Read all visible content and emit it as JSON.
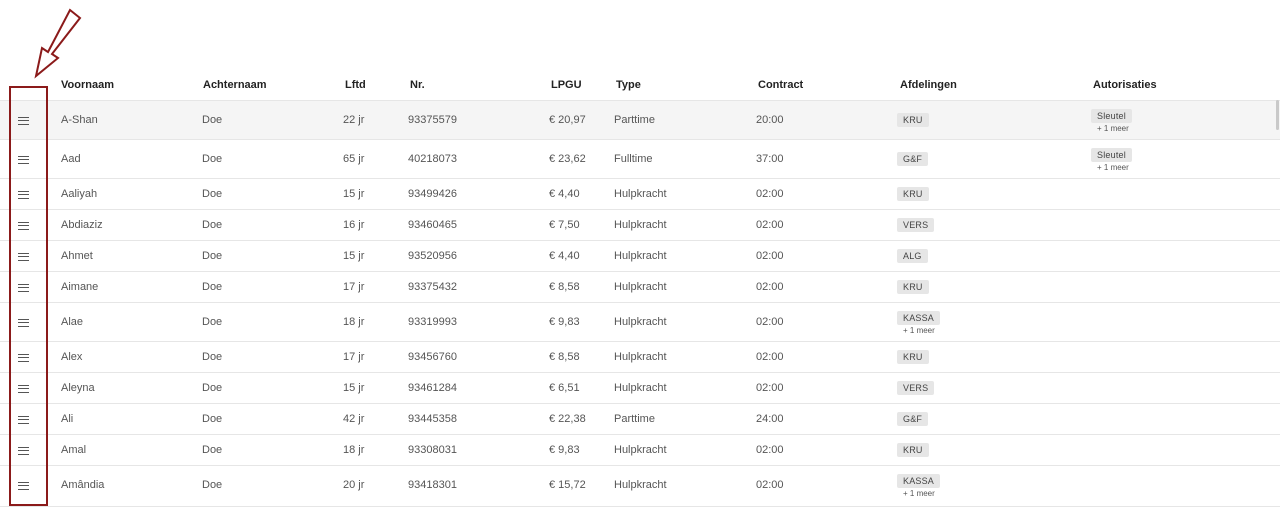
{
  "columns": {
    "voornaam": "Voornaam",
    "achternaam": "Achternaam",
    "lftd": "Lftd",
    "nr": "Nr.",
    "lpgu": "LPGU",
    "type": "Type",
    "contract": "Contract",
    "afdelingen": "Afdelingen",
    "autorisaties": "Autorisaties"
  },
  "rows": [
    {
      "voornaam": "A-Shan",
      "achternaam": "Doe",
      "lftd": "22 jr",
      "nr": "93375579",
      "lpgu": "€ 20,97",
      "type": "Parttime",
      "contract": "20:00",
      "afdeling": "KRU",
      "afdeling_meer": "",
      "autorisatie": "Sleutel",
      "autorisatie_meer": "+ 1 meer"
    },
    {
      "voornaam": "Aad",
      "achternaam": "Doe",
      "lftd": "65 jr",
      "nr": "40218073",
      "lpgu": "€ 23,62",
      "type": "Fulltime",
      "contract": "37:00",
      "afdeling": "G&F",
      "afdeling_meer": "",
      "autorisatie": "Sleutel",
      "autorisatie_meer": "+ 1 meer"
    },
    {
      "voornaam": "Aaliyah",
      "achternaam": "Doe",
      "lftd": "15 jr",
      "nr": "93499426",
      "lpgu": "€ 4,40",
      "type": "Hulpkracht",
      "contract": "02:00",
      "afdeling": "KRU",
      "afdeling_meer": "",
      "autorisatie": "",
      "autorisatie_meer": ""
    },
    {
      "voornaam": "Abdiaziz",
      "achternaam": "Doe",
      "lftd": "16 jr",
      "nr": "93460465",
      "lpgu": "€ 7,50",
      "type": "Hulpkracht",
      "contract": "02:00",
      "afdeling": "VERS",
      "afdeling_meer": "",
      "autorisatie": "",
      "autorisatie_meer": ""
    },
    {
      "voornaam": "Ahmet",
      "achternaam": "Doe",
      "lftd": "15 jr",
      "nr": "93520956",
      "lpgu": "€ 4,40",
      "type": "Hulpkracht",
      "contract": "02:00",
      "afdeling": "ALG",
      "afdeling_meer": "",
      "autorisatie": "",
      "autorisatie_meer": ""
    },
    {
      "voornaam": "Aimane",
      "achternaam": "Doe",
      "lftd": "17 jr",
      "nr": "93375432",
      "lpgu": "€ 8,58",
      "type": "Hulpkracht",
      "contract": "02:00",
      "afdeling": "KRU",
      "afdeling_meer": "",
      "autorisatie": "",
      "autorisatie_meer": ""
    },
    {
      "voornaam": "Alae",
      "achternaam": "Doe",
      "lftd": "18 jr",
      "nr": "93319993",
      "lpgu": "€ 9,83",
      "type": "Hulpkracht",
      "contract": "02:00",
      "afdeling": "KASSA",
      "afdeling_meer": "+ 1 meer",
      "autorisatie": "",
      "autorisatie_meer": ""
    },
    {
      "voornaam": "Alex",
      "achternaam": "Doe",
      "lftd": "17 jr",
      "nr": "93456760",
      "lpgu": "€ 8,58",
      "type": "Hulpkracht",
      "contract": "02:00",
      "afdeling": "KRU",
      "afdeling_meer": "",
      "autorisatie": "",
      "autorisatie_meer": ""
    },
    {
      "voornaam": "Aleyna",
      "achternaam": "Doe",
      "lftd": "15 jr",
      "nr": "93461284",
      "lpgu": "€ 6,51",
      "type": "Hulpkracht",
      "contract": "02:00",
      "afdeling": "VERS",
      "afdeling_meer": "",
      "autorisatie": "",
      "autorisatie_meer": ""
    },
    {
      "voornaam": "Ali",
      "achternaam": "Doe",
      "lftd": "42 jr",
      "nr": "93445358",
      "lpgu": "€ 22,38",
      "type": "Parttime",
      "contract": "24:00",
      "afdeling": "G&F",
      "afdeling_meer": "",
      "autorisatie": "",
      "autorisatie_meer": ""
    },
    {
      "voornaam": "Amal",
      "achternaam": "Doe",
      "lftd": "18 jr",
      "nr": "93308031",
      "lpgu": "€ 9,83",
      "type": "Hulpkracht",
      "contract": "02:00",
      "afdeling": "KRU",
      "afdeling_meer": "",
      "autorisatie": "",
      "autorisatie_meer": ""
    },
    {
      "voornaam": "Amândia",
      "achternaam": "Doe",
      "lftd": "20 jr",
      "nr": "93418301",
      "lpgu": "€ 15,72",
      "type": "Hulpkracht",
      "contract": "02:00",
      "afdeling": "KASSA",
      "afdeling_meer": "+ 1 meer",
      "autorisatie": "",
      "autorisatie_meer": ""
    }
  ],
  "icons": {
    "drag_handle": "hamburger-icon",
    "annotation_arrow": "arrow-down-left-icon"
  },
  "colors": {
    "annotation": "#8b1a1a",
    "badge_bg": "#e6e6e6",
    "selected_row_bg": "#f5f5f5"
  }
}
